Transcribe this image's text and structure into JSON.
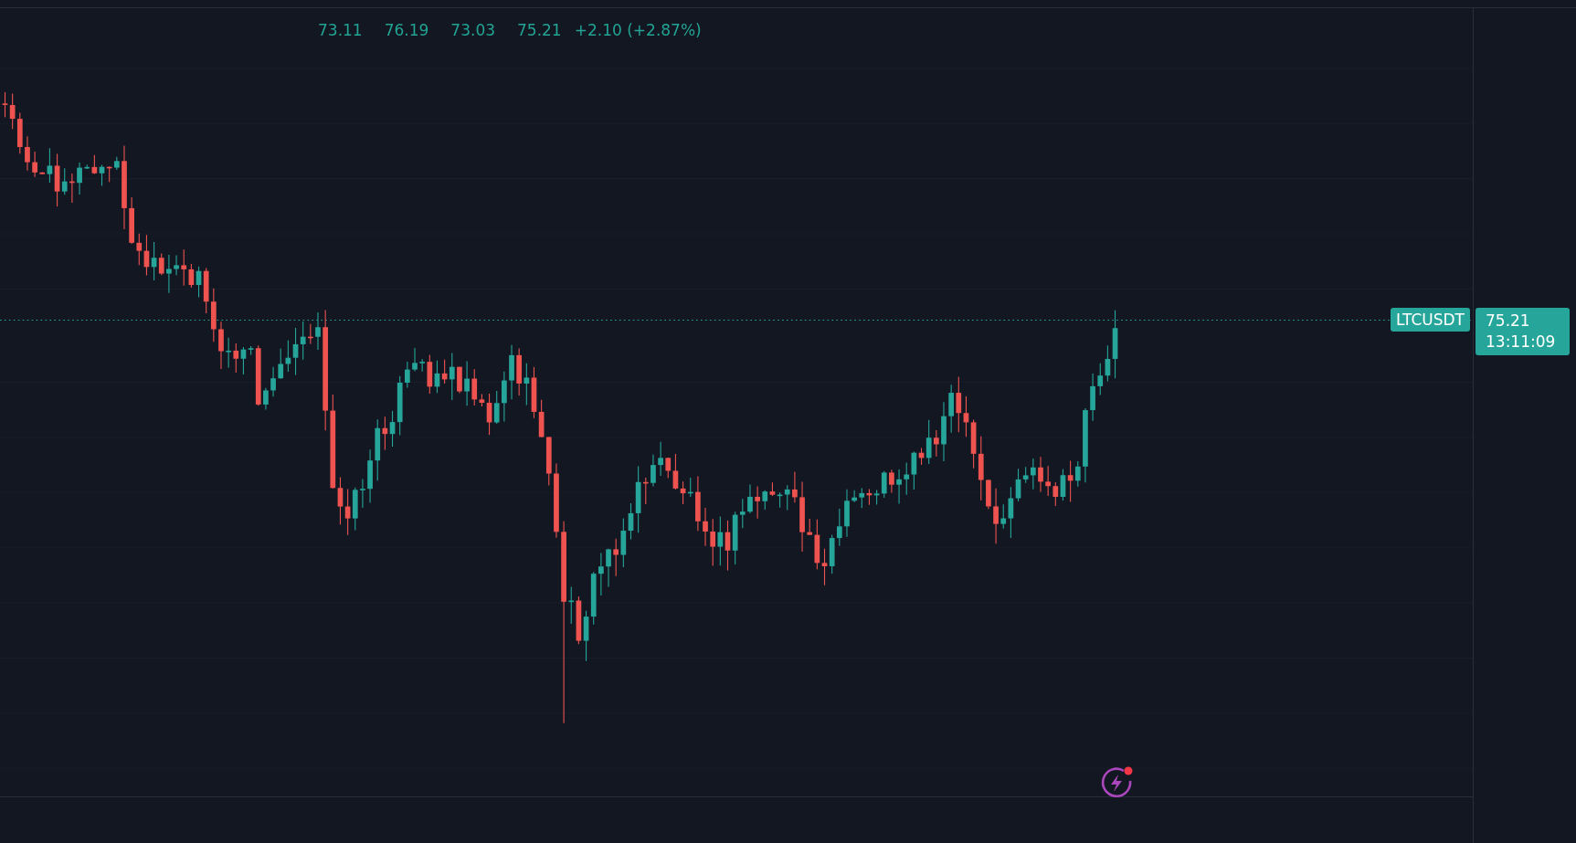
{
  "legend": {
    "open": "73.11",
    "high": "76.19",
    "low": "73.03",
    "close": "75.21",
    "change": "+2.10 (+2.87%)"
  },
  "symbol_label": "LTCUSDT",
  "price_label": {
    "price": "75.21",
    "countdown": "13:11:09"
  }
}
